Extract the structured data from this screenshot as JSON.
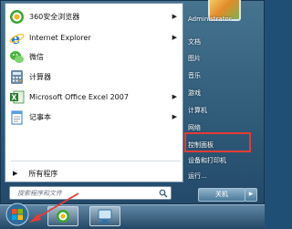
{
  "start_menu": {
    "programs": [
      {
        "label": "360安全浏览器",
        "icon": "browser-360-icon",
        "has_submenu": true
      },
      {
        "label": "Internet Explorer",
        "icon": "internet-explorer-icon",
        "has_submenu": true
      },
      {
        "label": "微信",
        "icon": "wechat-icon",
        "has_submenu": false
      },
      {
        "label": "计算器",
        "icon": "calculator-icon",
        "has_submenu": false
      },
      {
        "label": "Microsoft Office Excel 2007",
        "icon": "excel-icon",
        "has_submenu": true
      },
      {
        "label": "记事本",
        "icon": "notepad-icon",
        "has_submenu": true
      }
    ],
    "all_programs_label": "所有程序",
    "search_placeholder": "搜索程序和文件",
    "right_links": [
      {
        "label": "Administrator"
      },
      {
        "label": "文档"
      },
      {
        "label": "图片"
      },
      {
        "label": "音乐"
      },
      {
        "label": "游戏"
      },
      {
        "label": "计算机"
      },
      {
        "label": "网络"
      },
      {
        "label": "控制面板",
        "highlighted": true
      },
      {
        "label": "设备和打印机"
      },
      {
        "label": "运行..."
      }
    ],
    "shutdown_label": "关机"
  },
  "taskbar": {
    "items": [
      "start-button",
      "browser-360-taskbar",
      "remote-desktop-taskbar"
    ]
  },
  "colors": {
    "highlight_border": "#e53b34",
    "menu_blue": "#2f5a78"
  }
}
